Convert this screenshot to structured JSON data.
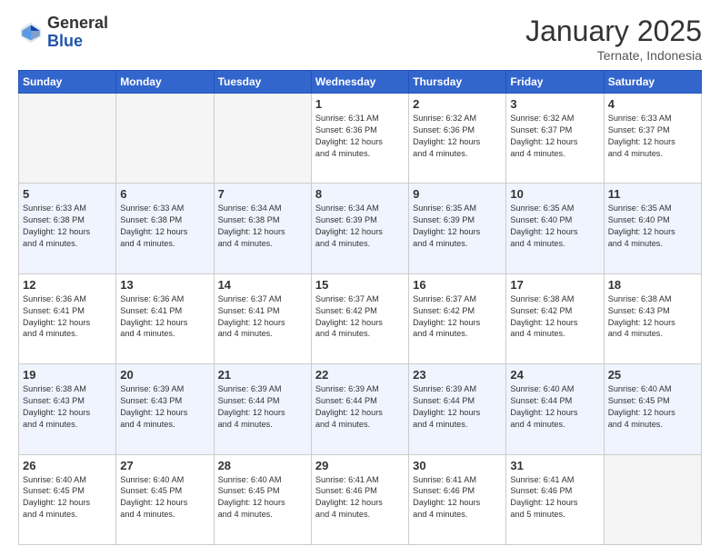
{
  "logo": {
    "general": "General",
    "blue": "Blue"
  },
  "header": {
    "month": "January 2025",
    "location": "Ternate, Indonesia"
  },
  "weekdays": [
    "Sunday",
    "Monday",
    "Tuesday",
    "Wednesday",
    "Thursday",
    "Friday",
    "Saturday"
  ],
  "weeks": [
    [
      {
        "day": "",
        "info": ""
      },
      {
        "day": "",
        "info": ""
      },
      {
        "day": "",
        "info": ""
      },
      {
        "day": "1",
        "info": "Sunrise: 6:31 AM\nSunset: 6:36 PM\nDaylight: 12 hours\nand 4 minutes."
      },
      {
        "day": "2",
        "info": "Sunrise: 6:32 AM\nSunset: 6:36 PM\nDaylight: 12 hours\nand 4 minutes."
      },
      {
        "day": "3",
        "info": "Sunrise: 6:32 AM\nSunset: 6:37 PM\nDaylight: 12 hours\nand 4 minutes."
      },
      {
        "day": "4",
        "info": "Sunrise: 6:33 AM\nSunset: 6:37 PM\nDaylight: 12 hours\nand 4 minutes."
      }
    ],
    [
      {
        "day": "5",
        "info": "Sunrise: 6:33 AM\nSunset: 6:38 PM\nDaylight: 12 hours\nand 4 minutes."
      },
      {
        "day": "6",
        "info": "Sunrise: 6:33 AM\nSunset: 6:38 PM\nDaylight: 12 hours\nand 4 minutes."
      },
      {
        "day": "7",
        "info": "Sunrise: 6:34 AM\nSunset: 6:38 PM\nDaylight: 12 hours\nand 4 minutes."
      },
      {
        "day": "8",
        "info": "Sunrise: 6:34 AM\nSunset: 6:39 PM\nDaylight: 12 hours\nand 4 minutes."
      },
      {
        "day": "9",
        "info": "Sunrise: 6:35 AM\nSunset: 6:39 PM\nDaylight: 12 hours\nand 4 minutes."
      },
      {
        "day": "10",
        "info": "Sunrise: 6:35 AM\nSunset: 6:40 PM\nDaylight: 12 hours\nand 4 minutes."
      },
      {
        "day": "11",
        "info": "Sunrise: 6:35 AM\nSunset: 6:40 PM\nDaylight: 12 hours\nand 4 minutes."
      }
    ],
    [
      {
        "day": "12",
        "info": "Sunrise: 6:36 AM\nSunset: 6:41 PM\nDaylight: 12 hours\nand 4 minutes."
      },
      {
        "day": "13",
        "info": "Sunrise: 6:36 AM\nSunset: 6:41 PM\nDaylight: 12 hours\nand 4 minutes."
      },
      {
        "day": "14",
        "info": "Sunrise: 6:37 AM\nSunset: 6:41 PM\nDaylight: 12 hours\nand 4 minutes."
      },
      {
        "day": "15",
        "info": "Sunrise: 6:37 AM\nSunset: 6:42 PM\nDaylight: 12 hours\nand 4 minutes."
      },
      {
        "day": "16",
        "info": "Sunrise: 6:37 AM\nSunset: 6:42 PM\nDaylight: 12 hours\nand 4 minutes."
      },
      {
        "day": "17",
        "info": "Sunrise: 6:38 AM\nSunset: 6:42 PM\nDaylight: 12 hours\nand 4 minutes."
      },
      {
        "day": "18",
        "info": "Sunrise: 6:38 AM\nSunset: 6:43 PM\nDaylight: 12 hours\nand 4 minutes."
      }
    ],
    [
      {
        "day": "19",
        "info": "Sunrise: 6:38 AM\nSunset: 6:43 PM\nDaylight: 12 hours\nand 4 minutes."
      },
      {
        "day": "20",
        "info": "Sunrise: 6:39 AM\nSunset: 6:43 PM\nDaylight: 12 hours\nand 4 minutes."
      },
      {
        "day": "21",
        "info": "Sunrise: 6:39 AM\nSunset: 6:44 PM\nDaylight: 12 hours\nand 4 minutes."
      },
      {
        "day": "22",
        "info": "Sunrise: 6:39 AM\nSunset: 6:44 PM\nDaylight: 12 hours\nand 4 minutes."
      },
      {
        "day": "23",
        "info": "Sunrise: 6:39 AM\nSunset: 6:44 PM\nDaylight: 12 hours\nand 4 minutes."
      },
      {
        "day": "24",
        "info": "Sunrise: 6:40 AM\nSunset: 6:44 PM\nDaylight: 12 hours\nand 4 minutes."
      },
      {
        "day": "25",
        "info": "Sunrise: 6:40 AM\nSunset: 6:45 PM\nDaylight: 12 hours\nand 4 minutes."
      }
    ],
    [
      {
        "day": "26",
        "info": "Sunrise: 6:40 AM\nSunset: 6:45 PM\nDaylight: 12 hours\nand 4 minutes."
      },
      {
        "day": "27",
        "info": "Sunrise: 6:40 AM\nSunset: 6:45 PM\nDaylight: 12 hours\nand 4 minutes."
      },
      {
        "day": "28",
        "info": "Sunrise: 6:40 AM\nSunset: 6:45 PM\nDaylight: 12 hours\nand 4 minutes."
      },
      {
        "day": "29",
        "info": "Sunrise: 6:41 AM\nSunset: 6:46 PM\nDaylight: 12 hours\nand 4 minutes."
      },
      {
        "day": "30",
        "info": "Sunrise: 6:41 AM\nSunset: 6:46 PM\nDaylight: 12 hours\nand 4 minutes."
      },
      {
        "day": "31",
        "info": "Sunrise: 6:41 AM\nSunset: 6:46 PM\nDaylight: 12 hours\nand 5 minutes."
      },
      {
        "day": "",
        "info": ""
      }
    ]
  ]
}
